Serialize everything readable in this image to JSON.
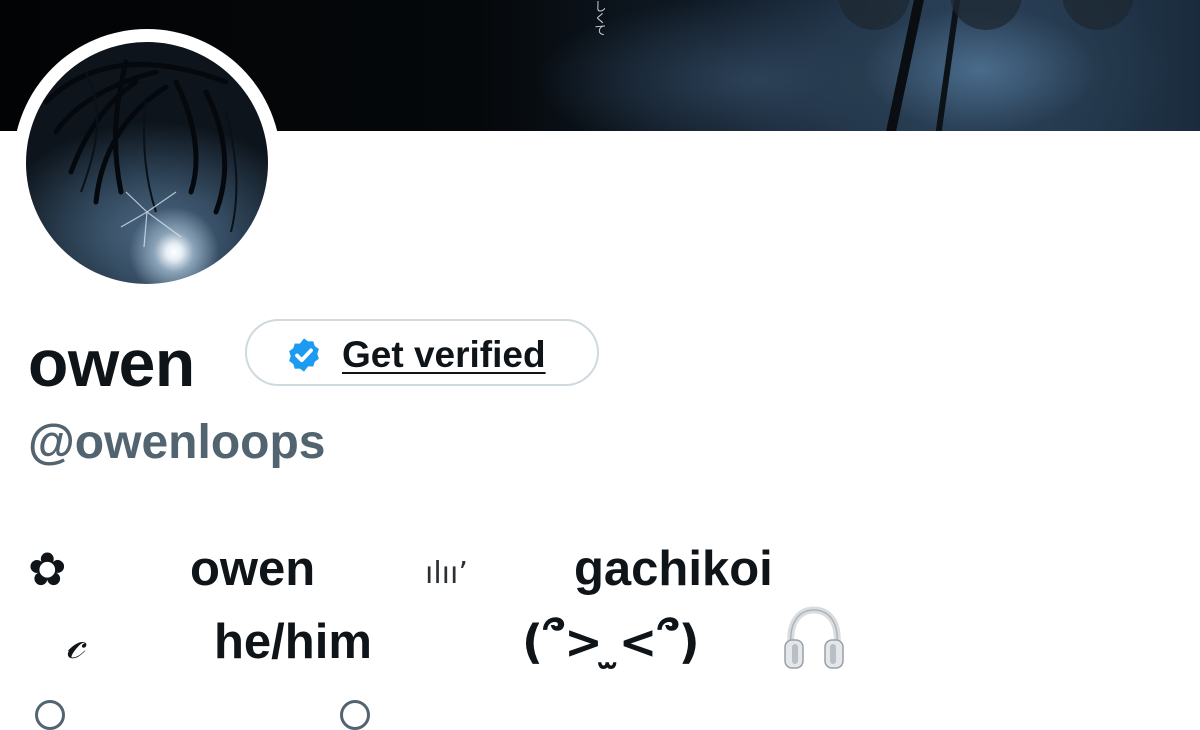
{
  "banner": {
    "caption_text": "しくて"
  },
  "profile": {
    "display_name": "owen",
    "handle": "@owenloops",
    "get_verified_label": "Get verified",
    "verified_badge_color": "#1d9bf0"
  },
  "bio": {
    "line1": {
      "flower": "✿",
      "name": "owen",
      "bars": "ılıı’",
      "word": "gachikoi"
    },
    "line2": {
      "script": "𝒸",
      "pronouns": "he/him",
      "kaomoji": "(՞>  ̫<՞)",
      "headphones_icon": "headphones-icon"
    }
  },
  "colors": {
    "text_primary": "#0f1419",
    "text_secondary": "#536471",
    "pill_border": "#cfd9de",
    "accent": "#1d9bf0"
  }
}
